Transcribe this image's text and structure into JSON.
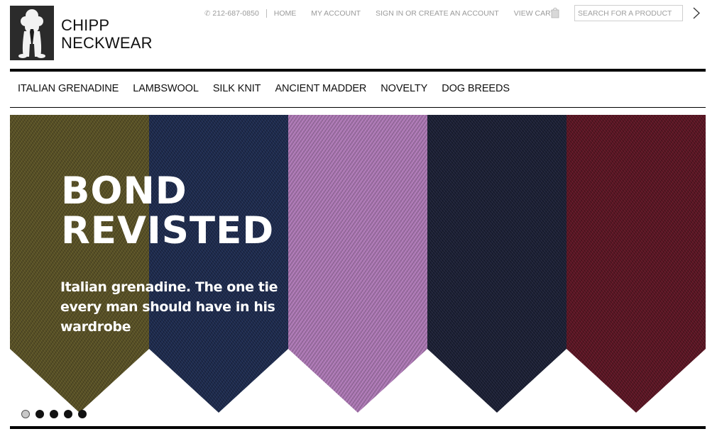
{
  "brand": {
    "line1": "CHIPP",
    "line2": "NECKWEAR"
  },
  "topbar": {
    "phone": "212-687-0850",
    "home": "HOME",
    "my_account": "MY ACCOUNT",
    "sign_in": "SIGN IN OR CREATE AN ACCOUNT",
    "view_cart": "VIEW CART"
  },
  "search": {
    "placeholder": "SEARCH FOR A PRODUCT"
  },
  "nav": {
    "items": [
      {
        "label": "ITALIAN GRENADINE"
      },
      {
        "label": "LAMBSWOOL"
      },
      {
        "label": "SILK KNIT"
      },
      {
        "label": "ANCIENT MADDER"
      },
      {
        "label": "NOVELTY"
      },
      {
        "label": "DOG BREEDS"
      }
    ]
  },
  "banner": {
    "headline_line1": "BOND",
    "headline_line2": "REVISTED",
    "subline": "Italian grenadine. The one tie every man should have in his wardrobe",
    "tie_colors": [
      "#5a5224",
      "#1c2a4e",
      "#b07ab8",
      "#1a1e34",
      "#5c1322"
    ],
    "slides": {
      "count": 5,
      "active": 1
    }
  },
  "colors": {
    "accent": "#000000",
    "muted_text": "#9a9a9a"
  }
}
